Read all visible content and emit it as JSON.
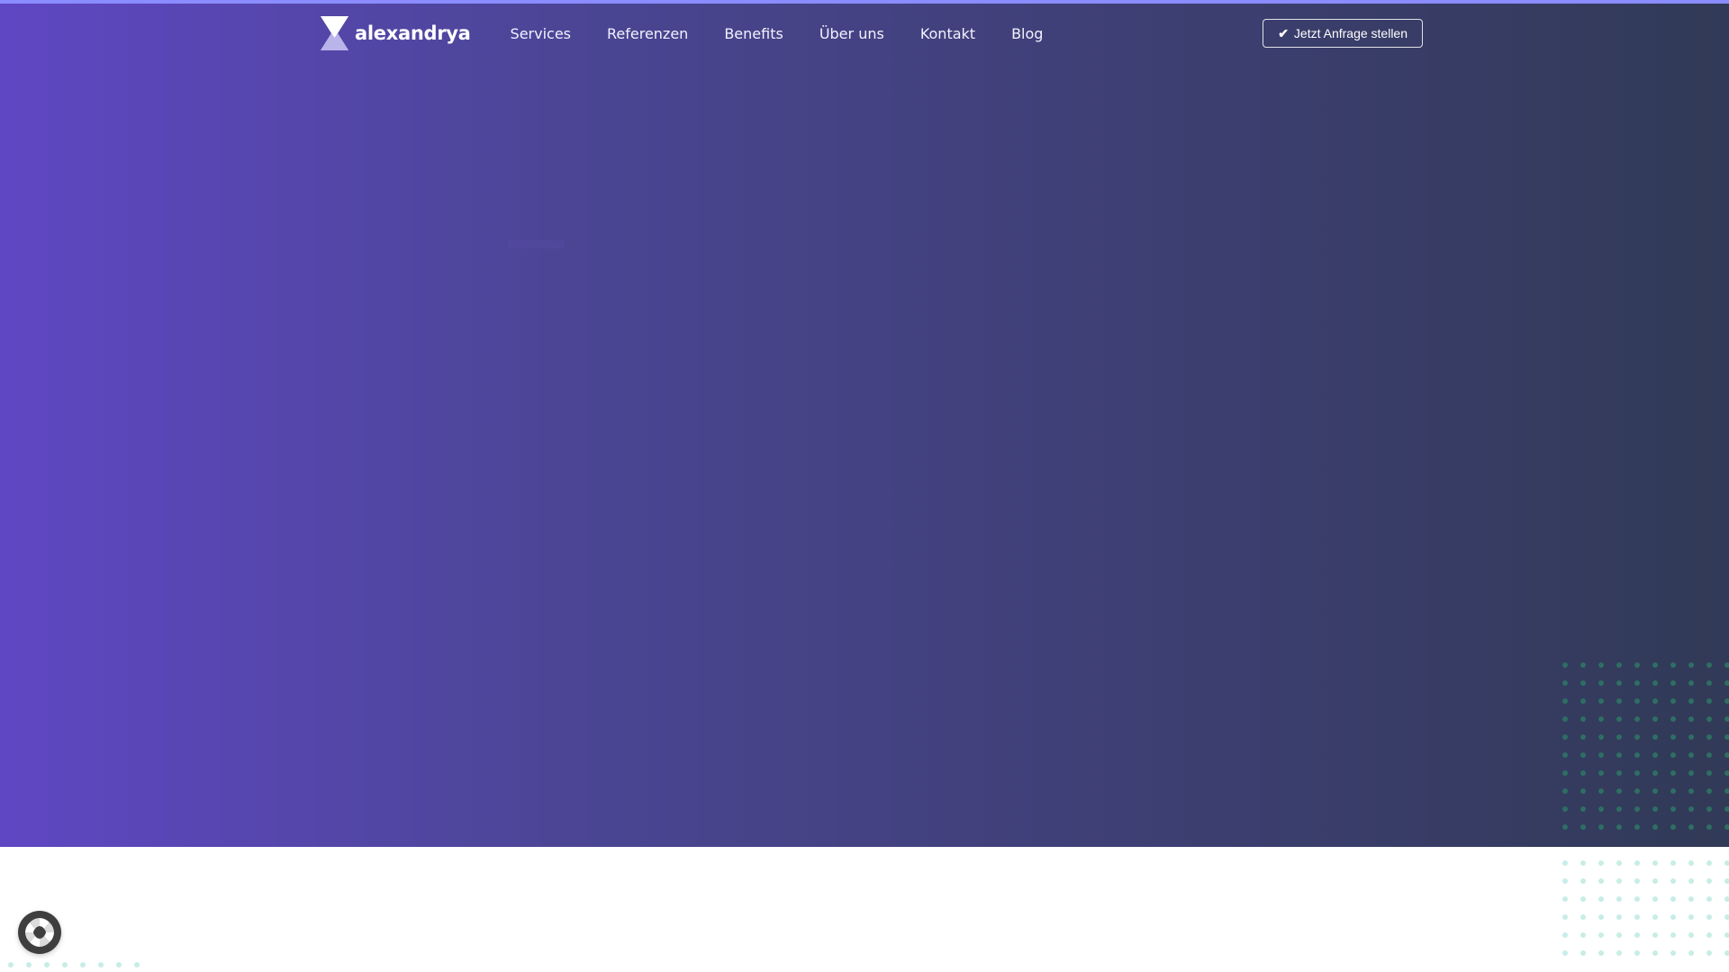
{
  "brand": {
    "name": "alexandrya"
  },
  "nav": {
    "items": [
      {
        "label": "Services"
      },
      {
        "label": "Referenzen"
      },
      {
        "label": "Benefits"
      },
      {
        "label": "Über uns"
      },
      {
        "label": "Kontakt"
      },
      {
        "label": "Blog"
      }
    ]
  },
  "cta": {
    "label": "Jetzt Anfrage stellen",
    "icon": "check-icon"
  },
  "colors": {
    "hero_gradient_start": "#5f47c3",
    "hero_gradient_end": "#313a57",
    "top_accent": "#8a8cff",
    "dots_dark": "#2f6e63",
    "dots_light": "#c7ede6",
    "widget": "#3f3f3f"
  },
  "widget": {
    "icon": "cookie-settings-icon"
  }
}
